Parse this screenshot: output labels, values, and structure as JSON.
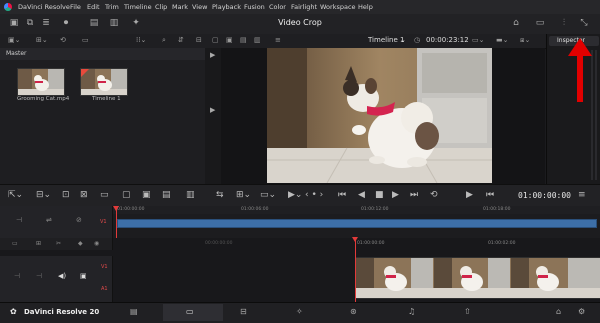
{
  "app": {
    "name": "DaVinci Resolve"
  },
  "menu": [
    "File",
    "Edit",
    "Trim",
    "Timeline",
    "Clip",
    "Mark",
    "View",
    "Playback",
    "Fusion",
    "Color",
    "Fairlight",
    "Workspace",
    "Help"
  ],
  "project_title": "Video Crop",
  "media_pool": {
    "bin": "Master",
    "clips": [
      {
        "label": "Grooming Cat.mp4"
      },
      {
        "label": "Timeline 1"
      }
    ]
  },
  "viewer": {
    "timeline_selector": "Timeline 1",
    "timecode_top": "00:00:23:12",
    "timecode_current": "01:00:00:00"
  },
  "inspector": {
    "label": "Inspector"
  },
  "timeline_upper": {
    "tick_labels": [
      "01:00:00:00",
      "01:00:06:00",
      "01:00:12:00",
      "01:00:18:00"
    ],
    "track_label": "V1"
  },
  "timeline_lower": {
    "tick_labels": [
      "01:00:00:00",
      "01:00:02:00"
    ],
    "center_label": "00:00:00:00",
    "video_track_label": "V1",
    "audio_track_label": "A1"
  },
  "bottom": {
    "brand": "DaVinci Resolve 20"
  },
  "annotation": {
    "arrow_color": "#e10000"
  }
}
